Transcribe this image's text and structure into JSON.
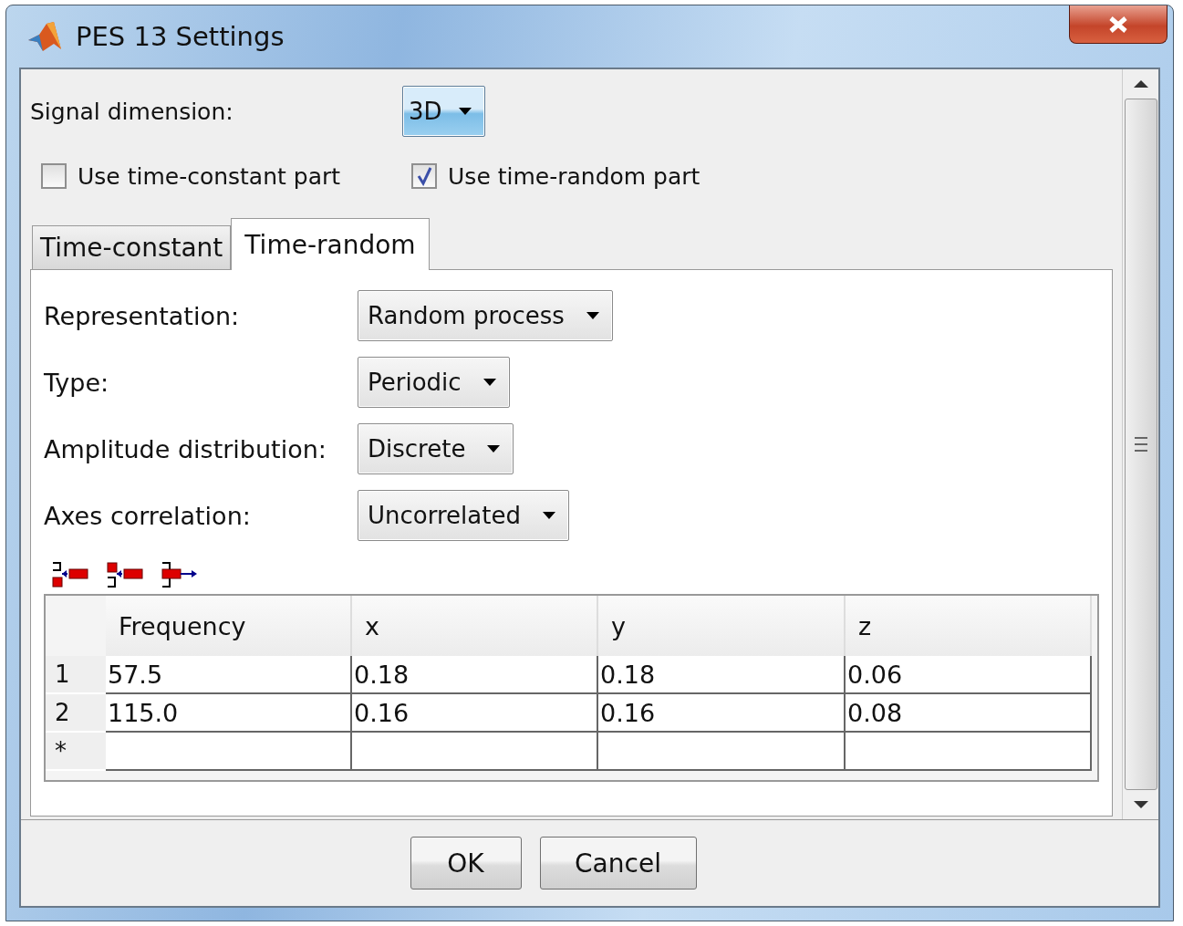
{
  "window": {
    "title": "PES 13 Settings"
  },
  "signal_dimension": {
    "label": "Signal dimension:",
    "value": "3D"
  },
  "options": [
    {
      "label": "Use time-constant part",
      "checked": false
    },
    {
      "label": "Use time-random part",
      "checked": true
    }
  ],
  "tabs": [
    {
      "label": "Time-constant",
      "selected": false
    },
    {
      "label": "Time-random",
      "selected": true
    }
  ],
  "fields": [
    {
      "label": "Representation:",
      "value": "Random process"
    },
    {
      "label": "Type:",
      "value": "Periodic"
    },
    {
      "label": "Amplitude distribution:",
      "value": "Discrete"
    },
    {
      "label": "Axes correlation:",
      "value": "Uncorrelated"
    }
  ],
  "table": {
    "columns": [
      "Frequency",
      "x",
      "y",
      "z"
    ],
    "rows": [
      {
        "header": "1",
        "cells": [
          "57.5",
          "0.18",
          "0.18",
          "0.06"
        ]
      },
      {
        "header": "2",
        "cells": [
          "115.0",
          "0.16",
          "0.16",
          "0.08"
        ]
      },
      {
        "header": "*"
      }
    ]
  },
  "buttons": [
    "OK",
    "Cancel"
  ]
}
